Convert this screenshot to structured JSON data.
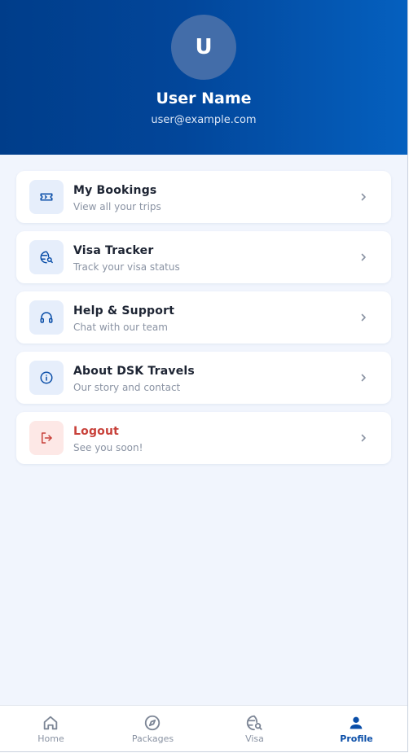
{
  "profile": {
    "avatar_initial": "U",
    "name": "User Name",
    "email": "user@example.com"
  },
  "menu": [
    {
      "title": "My Bookings",
      "subtitle": "View all your trips",
      "icon": "ticket-icon"
    },
    {
      "title": "Visa Tracker",
      "subtitle": "Track your visa status",
      "icon": "globe-search-icon"
    },
    {
      "title": "Help & Support",
      "subtitle": "Chat with our team",
      "icon": "headset-icon"
    },
    {
      "title": "About DSK Travels",
      "subtitle": "Our story and contact",
      "icon": "info-icon"
    },
    {
      "title": "Logout",
      "subtitle": "See you soon!",
      "icon": "logout-icon"
    }
  ],
  "nav": [
    {
      "label": "Home",
      "icon": "home-icon"
    },
    {
      "label": "Packages",
      "icon": "compass-icon"
    },
    {
      "label": "Visa",
      "icon": "globe-search-icon"
    },
    {
      "label": "Profile",
      "icon": "person-icon",
      "active": true
    }
  ],
  "colors": {
    "primary": "#0a4ea8",
    "header_start": "#003d8a",
    "header_end": "#0560bf",
    "danger": "#c8413a",
    "background": "#f1f5fd"
  }
}
